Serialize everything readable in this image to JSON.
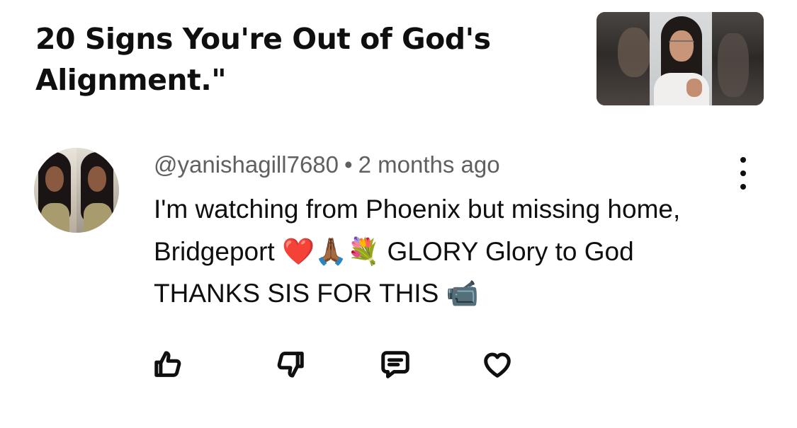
{
  "video": {
    "title": "20 Signs You're Out of God's Alignment.\""
  },
  "comment": {
    "author": "@yanishagill7680",
    "separator": "•",
    "time": "2 months ago",
    "text": "I'm watching from Phoenix  but missing home, Bridgeport ❤️🙏🏾💐 GLORY Glory to God THANKS SIS FOR THIS 📹"
  },
  "icons": {
    "like": "thumbs-up-icon",
    "dislike": "thumbs-down-icon",
    "reply": "comment-icon",
    "love": "heart-icon",
    "more": "more-vertical-icon"
  },
  "colors": {
    "primary_text": "#0f0f0f",
    "secondary_text": "#606060",
    "background": "#ffffff"
  }
}
